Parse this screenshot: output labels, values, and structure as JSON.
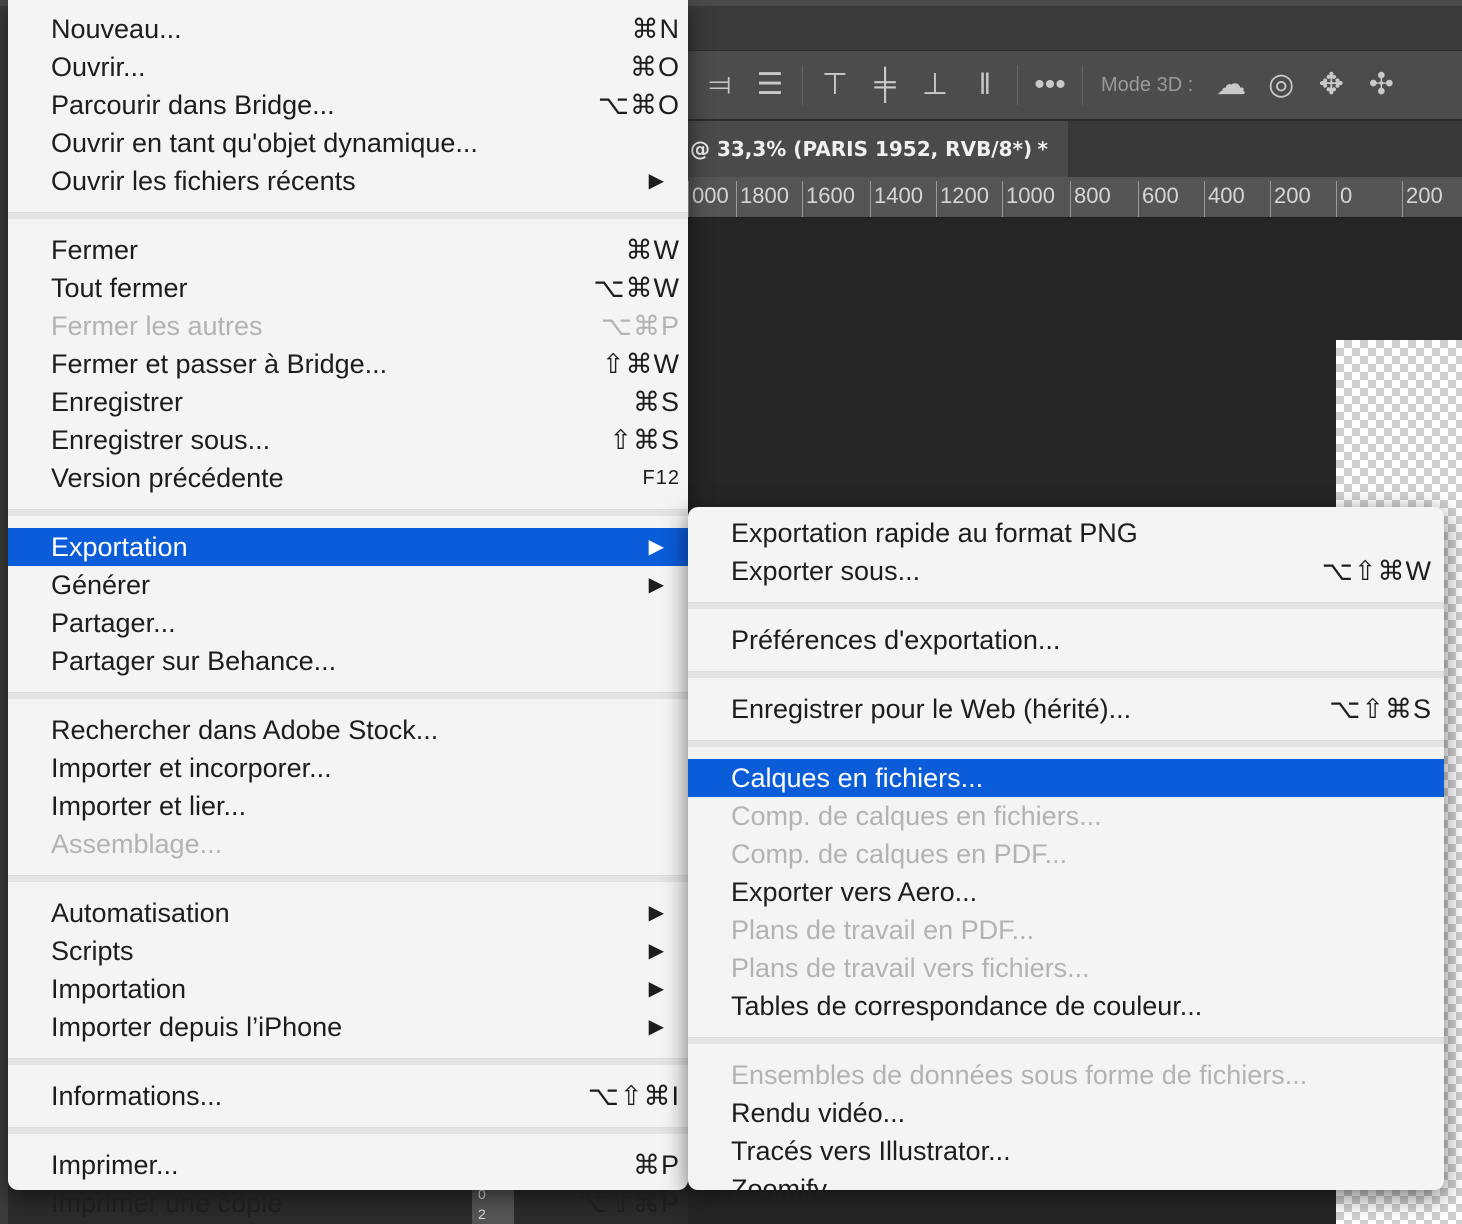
{
  "app": {
    "document_tab": "@ 33,3% (PARIS 1952, RVB/8*)",
    "document_tab_modified": "*",
    "options_bar": {
      "mode3d_label": "Mode 3D :",
      "more_label": "•••"
    },
    "ruler_ticks": [
      "000",
      "1800",
      "1600",
      "1400",
      "1200",
      "1000",
      "800",
      "600",
      "400",
      "200",
      "0",
      "200"
    ],
    "bottom_ruler": [
      "0",
      "2"
    ]
  },
  "file_menu": {
    "groups": [
      [
        {
          "label": "Nouveau...",
          "shortcut": "⌘N"
        },
        {
          "label": "Ouvrir...",
          "shortcut": "⌘O"
        },
        {
          "label": "Parcourir dans Bridge...",
          "shortcut": "⌥⌘O"
        },
        {
          "label": "Ouvrir en tant qu'objet dynamique...",
          "shortcut": ""
        },
        {
          "label": "Ouvrir les fichiers récents",
          "submenu": true
        }
      ],
      [
        {
          "label": "Fermer",
          "shortcut": "⌘W"
        },
        {
          "label": "Tout fermer",
          "shortcut": "⌥⌘W"
        },
        {
          "label": "Fermer les autres",
          "shortcut": "⌥⌘P",
          "disabled": true
        },
        {
          "label": "Fermer et passer à Bridge...",
          "shortcut": "⇧⌘W"
        },
        {
          "label": "Enregistrer",
          "shortcut": "⌘S"
        },
        {
          "label": "Enregistrer sous...",
          "shortcut": "⇧⌘S"
        },
        {
          "label": "Version précédente",
          "shortcut": "F12",
          "small": true
        }
      ],
      [
        {
          "label": "Exportation",
          "submenu": true,
          "selected": true
        },
        {
          "label": "Générer",
          "submenu": true
        },
        {
          "label": "Partager...",
          "shortcut": ""
        },
        {
          "label": "Partager sur Behance...",
          "shortcut": ""
        }
      ],
      [
        {
          "label": "Rechercher dans Adobe Stock...",
          "shortcut": ""
        },
        {
          "label": "Importer et incorporer...",
          "shortcut": ""
        },
        {
          "label": "Importer et lier...",
          "shortcut": ""
        },
        {
          "label": "Assemblage...",
          "shortcut": "",
          "disabled": true
        }
      ],
      [
        {
          "label": "Automatisation",
          "submenu": true
        },
        {
          "label": "Scripts",
          "submenu": true
        },
        {
          "label": "Importation",
          "submenu": true
        },
        {
          "label": "Importer depuis l’iPhone",
          "submenu": true
        }
      ],
      [
        {
          "label": "Informations...",
          "shortcut": "⌥⇧⌘I"
        }
      ],
      [
        {
          "label": "Imprimer...",
          "shortcut": "⌘P"
        },
        {
          "label": "Imprimer une copie",
          "shortcut": "⌥⇧⌘P"
        }
      ]
    ],
    "submenu_arrow": "▶"
  },
  "export_submenu": {
    "groups": [
      [
        {
          "label": "Exportation rapide au format PNG",
          "shortcut": ""
        },
        {
          "label": "Exporter sous...",
          "shortcut": "⌥⇧⌘W"
        }
      ],
      [
        {
          "label": "Préférences d'exportation...",
          "shortcut": ""
        }
      ],
      [
        {
          "label": "Enregistrer pour le Web (hérité)...",
          "shortcut": "⌥⇧⌘S"
        }
      ],
      [
        {
          "label": "Calques en fichiers...",
          "selected": true
        },
        {
          "label": "Comp. de calques en fichiers...",
          "disabled": true
        },
        {
          "label": "Comp. de calques en PDF...",
          "disabled": true
        },
        {
          "label": "Exporter vers Aero..."
        },
        {
          "label": "Plans de travail en PDF...",
          "disabled": true
        },
        {
          "label": "Plans de travail vers fichiers...",
          "disabled": true
        },
        {
          "label": "Tables de correspondance de couleur..."
        }
      ],
      [
        {
          "label": "Ensembles de données sous forme de fichiers...",
          "disabled": true
        },
        {
          "label": "Rendu vidéo..."
        },
        {
          "label": "Tracés vers Illustrator..."
        },
        {
          "label": "Zoomify..."
        }
      ]
    ]
  },
  "colors": {
    "selection": "#0b5cd8",
    "menu_bg": "#f4f4f4",
    "disabled_text": "#b3b3b3"
  }
}
